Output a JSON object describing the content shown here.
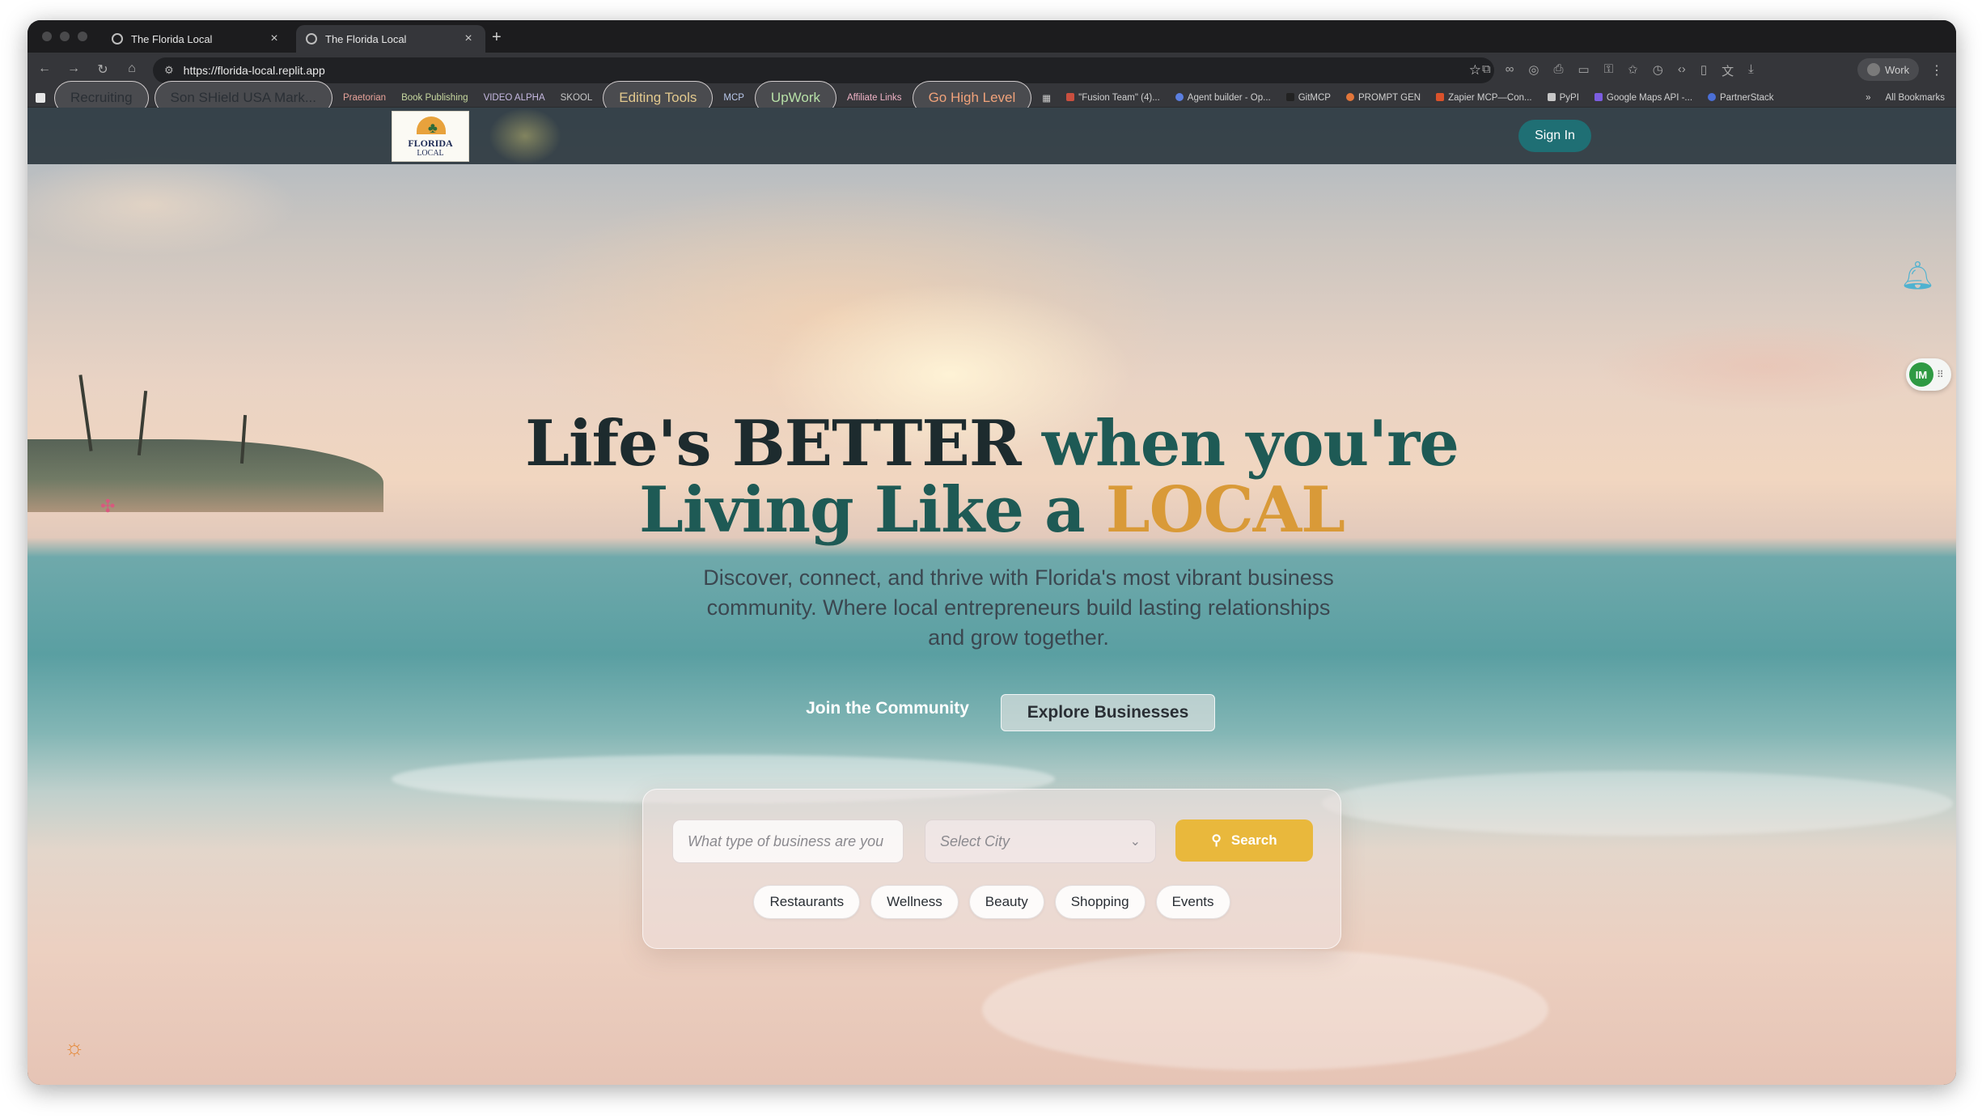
{
  "browser": {
    "tabs": [
      {
        "title": "The Florida Local",
        "active": false
      },
      {
        "title": "The Florida Local",
        "active": true
      }
    ],
    "new_tab_icon": "+",
    "close_icon": "×",
    "url": "https://florida-local.replit.app",
    "profile_label": "Work",
    "bookmarks": [
      {
        "label": "Recruiting",
        "chip": true
      },
      {
        "label": "Son SHield USA Mark...",
        "chip": true
      },
      {
        "label": "Praetorian",
        "chip": false
      },
      {
        "label": "Book Publishing",
        "chip": false
      },
      {
        "label": "VIDEO ALPHA",
        "chip": false
      },
      {
        "label": "SKOOL",
        "chip": false
      },
      {
        "label": "Editing Tools",
        "chip": true
      },
      {
        "label": "MCP",
        "chip": false
      },
      {
        "label": "UpWork",
        "chip": true
      },
      {
        "label": "Affiliate Links",
        "chip": false
      },
      {
        "label": "Go High Level",
        "chip": true
      },
      {
        "label": "\"Fusion Team\" (4)...",
        "chip": false
      },
      {
        "label": "Agent builder - Op...",
        "chip": false
      },
      {
        "label": "GitMCP",
        "chip": false
      },
      {
        "label": "PROMPT GEN",
        "chip": false
      },
      {
        "label": "Zapier MCP—Con...",
        "chip": false
      },
      {
        "label": "PyPI",
        "chip": false
      },
      {
        "label": "Google Maps API -...",
        "chip": false
      },
      {
        "label": "PartnerStack",
        "chip": false
      }
    ],
    "all_bookmarks_label": "All Bookmarks"
  },
  "header": {
    "logo_line1": "FLORIDA",
    "logo_line2": "LOCAL",
    "signin_label": "Sign In"
  },
  "hero": {
    "title_line1_a": "Life's",
    "title_line1_b": "BETTER",
    "title_line1_c": "when you're",
    "title_line2_a": "Living Like a",
    "title_line2_b": "LOCAL",
    "subtitle": "Discover, connect, and thrive with Florida's most vibrant business community. Where local entrepreneurs build lasting relationships and grow together.",
    "join_label": "Join the Community",
    "explore_label": "Explore Businesses"
  },
  "search": {
    "business_placeholder": "What type of business are you",
    "city_placeholder": "Select City",
    "search_label": "Search",
    "categories": [
      "Restaurants",
      "Wellness",
      "Beauty",
      "Shopping",
      "Events"
    ]
  },
  "colors": {
    "header_bg": "#1c2830",
    "signin_bg": "#1f6f74",
    "search_bg": "#e9b83c",
    "title_dark": "#1d2b2e",
    "title_teal": "#1e5a55",
    "title_gold": "#d99a38"
  },
  "icons": {
    "bell": "bell-icon",
    "sun": "sun-icon",
    "extension": "extension-badge-icon",
    "sparkle": "sparkle-icon"
  }
}
